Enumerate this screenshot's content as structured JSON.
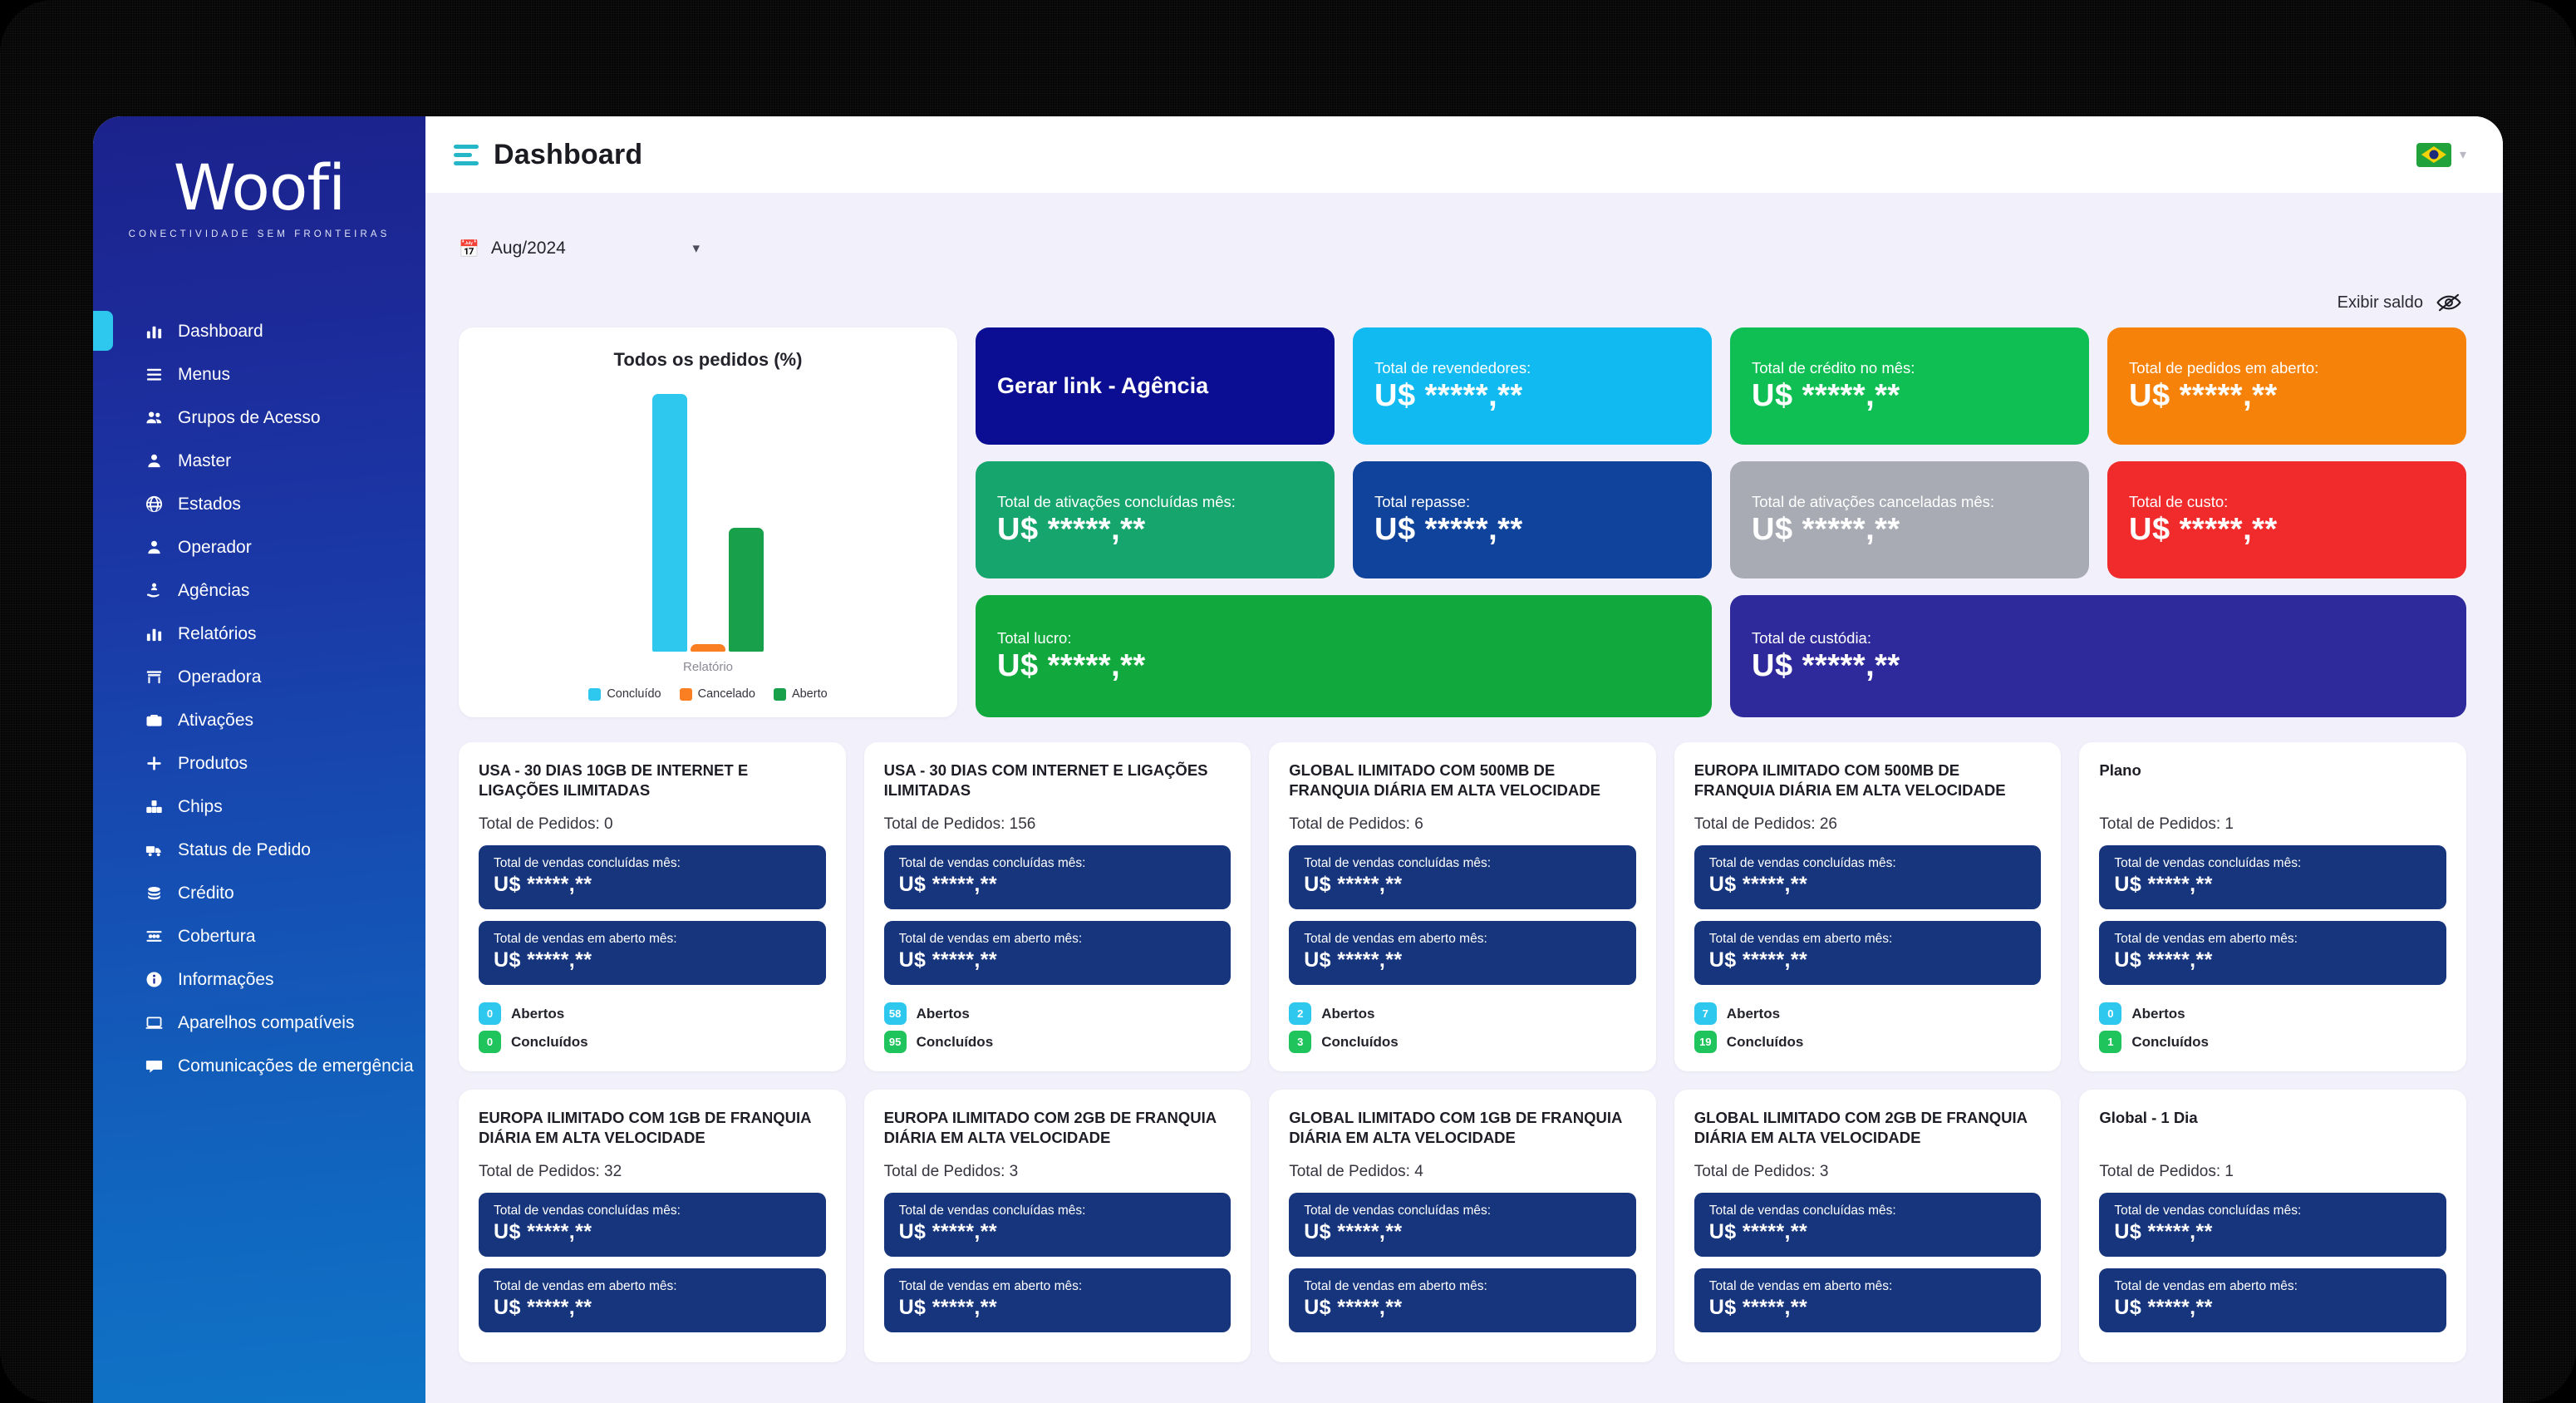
{
  "brand": {
    "name": "Woofi",
    "tagline": "CONECTIVIDADE SEM FRONTEIRAS"
  },
  "topbar": {
    "title": "Dashboard",
    "menu_icon": "hamburger-icon",
    "flag": "brazil-flag-icon"
  },
  "filters": {
    "period_value": "Aug/2024",
    "calendar_icon": "calendar-icon",
    "chevron_icon": "chevron-down-icon",
    "balance_label": "Exibir saldo",
    "balance_icon": "eye-off-icon"
  },
  "sidebar": {
    "items": [
      {
        "label": "Dashboard",
        "icon": "chart-bar-icon",
        "active": true
      },
      {
        "label": "Menus",
        "icon": "list-icon",
        "active": false
      },
      {
        "label": "Grupos de Acesso",
        "icon": "users-icon",
        "active": false
      },
      {
        "label": "Master",
        "icon": "user-icon",
        "active": false
      },
      {
        "label": "Estados",
        "icon": "globe-icon",
        "active": false
      },
      {
        "label": "Operador",
        "icon": "user-icon",
        "active": false
      },
      {
        "label": "Agências",
        "icon": "hand-user-icon",
        "active": false
      },
      {
        "label": "Relatórios",
        "icon": "chart-bar-icon",
        "active": false
      },
      {
        "label": "Operadora",
        "icon": "store-icon",
        "active": false
      },
      {
        "label": "Ativações",
        "icon": "briefcase-icon",
        "active": false
      },
      {
        "label": "Produtos",
        "icon": "plus-icon",
        "active": false
      },
      {
        "label": "Chips",
        "icon": "sim-stack-icon",
        "active": false
      },
      {
        "label": "Status de Pedido",
        "icon": "truck-icon",
        "active": false
      },
      {
        "label": "Crédito",
        "icon": "coins-icon",
        "active": false
      },
      {
        "label": "Cobertura",
        "icon": "network-icon",
        "active": false
      },
      {
        "label": "Informações",
        "icon": "info-icon",
        "active": false
      },
      {
        "label": "Aparelhos compatíveis",
        "icon": "laptop-icon",
        "active": false
      },
      {
        "label": "Comunicações de emergência",
        "icon": "chat-icon",
        "active": false
      }
    ]
  },
  "chart_data": {
    "type": "bar",
    "title": "Todos os pedidos (%)",
    "xlabel": "Relatório",
    "ylabel": "",
    "ylim": [
      0,
      100
    ],
    "grid": false,
    "legend_position": "bottom",
    "categories": [
      "Concluído",
      "Cancelado",
      "Aberto"
    ],
    "values": [
      100,
      3,
      48
    ],
    "colors": [
      "#2ec8ef",
      "#f97f22",
      "#18a04a"
    ],
    "series": [
      {
        "name": "Concluído",
        "values": [
          100
        ],
        "color": "#2ec8ef"
      },
      {
        "name": "Cancelado",
        "values": [
          3
        ],
        "color": "#f97f22"
      },
      {
        "name": "Aberto",
        "values": [
          48
        ],
        "color": "#18a04a"
      }
    ]
  },
  "stats": [
    {
      "label": "Gerar link - Agência",
      "value": "",
      "color": "#0b0e93",
      "action": true,
      "span": 1
    },
    {
      "label": "Total de revendedores:",
      "value": "U$ *****,**",
      "color": "#11baf0",
      "action": false,
      "span": 1
    },
    {
      "label": "Total de crédito no mês:",
      "value": "U$ *****,**",
      "color": "#10bf54",
      "action": false,
      "span": 1
    },
    {
      "label": "Total de pedidos em aberto:",
      "value": "U$ *****,**",
      "color": "#f7820a",
      "action": false,
      "span": 1
    },
    {
      "label": "Total de ativações concluídas mês:",
      "value": "U$ *****,**",
      "color": "#16a56d",
      "action": false,
      "span": 1
    },
    {
      "label": "Total repasse:",
      "value": "U$ *****,**",
      "color": "#10439b",
      "action": false,
      "span": 1
    },
    {
      "label": "Total de ativações canceladas mês:",
      "value": "U$ *****,**",
      "color": "#a8abb3",
      "action": false,
      "span": 1
    },
    {
      "label": "Total de custo:",
      "value": "U$ *****,**",
      "color": "#f12b2b",
      "action": false,
      "span": 1
    },
    {
      "label": "Total lucro:",
      "value": "U$ *****,**",
      "color": "#11a93d",
      "action": false,
      "span": 2
    },
    {
      "label": "Total de custódia:",
      "value": "U$ *****,**",
      "color": "#2f2a9b",
      "action": false,
      "span": 2
    }
  ],
  "product_card_labels": {
    "orders_prefix": "Total de Pedidos:",
    "sales_done": "Total de vendas concluídas mês:",
    "sales_open": "Total de vendas em aberto mês:",
    "open_label": "Abertos",
    "done_label": "Concluídos"
  },
  "products": [
    {
      "title": "USA - 30 DIAS 10GB DE INTERNET E LIGAÇÕES ILIMITADAS",
      "uppercase": true,
      "orders": "0",
      "sales_done_value": "U$ *****,**",
      "sales_open_value": "U$ *****,**",
      "open_count": "0",
      "done_count": "0"
    },
    {
      "title": "USA - 30 DIAS COM INTERNET E LIGAÇÕES ILIMITADAS",
      "uppercase": true,
      "orders": "156",
      "sales_done_value": "U$ *****,**",
      "sales_open_value": "U$ *****,**",
      "open_count": "58",
      "done_count": "95"
    },
    {
      "title": "GLOBAL ILIMITADO COM 500MB DE FRANQUIA DIÁRIA EM ALTA VELOCIDADE",
      "uppercase": true,
      "orders": "6",
      "sales_done_value": "U$ *****,**",
      "sales_open_value": "U$ *****,**",
      "open_count": "2",
      "done_count": "3"
    },
    {
      "title": "EUROPA ILIMITADO COM 500MB DE FRANQUIA DIÁRIA EM ALTA VELOCIDADE",
      "uppercase": true,
      "orders": "26",
      "sales_done_value": "U$ *****,**",
      "sales_open_value": "U$ *****,**",
      "open_count": "7",
      "done_count": "19"
    },
    {
      "title": "Plano",
      "uppercase": false,
      "orders": "1",
      "sales_done_value": "U$ *****,**",
      "sales_open_value": "U$ *****,**",
      "open_count": "0",
      "done_count": "1"
    },
    {
      "title": "EUROPA ILIMITADO COM 1GB DE FRANQUIA DIÁRIA EM ALTA VELOCIDADE",
      "uppercase": true,
      "orders": "32",
      "sales_done_value": "U$ *****,**",
      "sales_open_value": "U$ *****,**",
      "open_count": "",
      "done_count": ""
    },
    {
      "title": "EUROPA ILIMITADO COM 2GB DE FRANQUIA DIÁRIA EM ALTA VELOCIDADE",
      "uppercase": true,
      "orders": "3",
      "sales_done_value": "U$ *****,**",
      "sales_open_value": "U$ *****,**",
      "open_count": "",
      "done_count": ""
    },
    {
      "title": "GLOBAL ILIMITADO COM 1GB DE FRANQUIA DIÁRIA EM ALTA VELOCIDADE",
      "uppercase": true,
      "orders": "4",
      "sales_done_value": "U$ *****,**",
      "sales_open_value": "U$ *****,**",
      "open_count": "",
      "done_count": ""
    },
    {
      "title": "GLOBAL ILIMITADO COM 2GB DE FRANQUIA DIÁRIA EM ALTA VELOCIDADE",
      "uppercase": true,
      "orders": "3",
      "sales_done_value": "U$ *****,**",
      "sales_open_value": "U$ *****,**",
      "open_count": "",
      "done_count": ""
    },
    {
      "title": "Global - 1 Dia",
      "uppercase": false,
      "orders": "1",
      "sales_done_value": "U$ *****,**",
      "sales_open_value": "U$ *****,**",
      "open_count": "",
      "done_count": ""
    }
  ]
}
